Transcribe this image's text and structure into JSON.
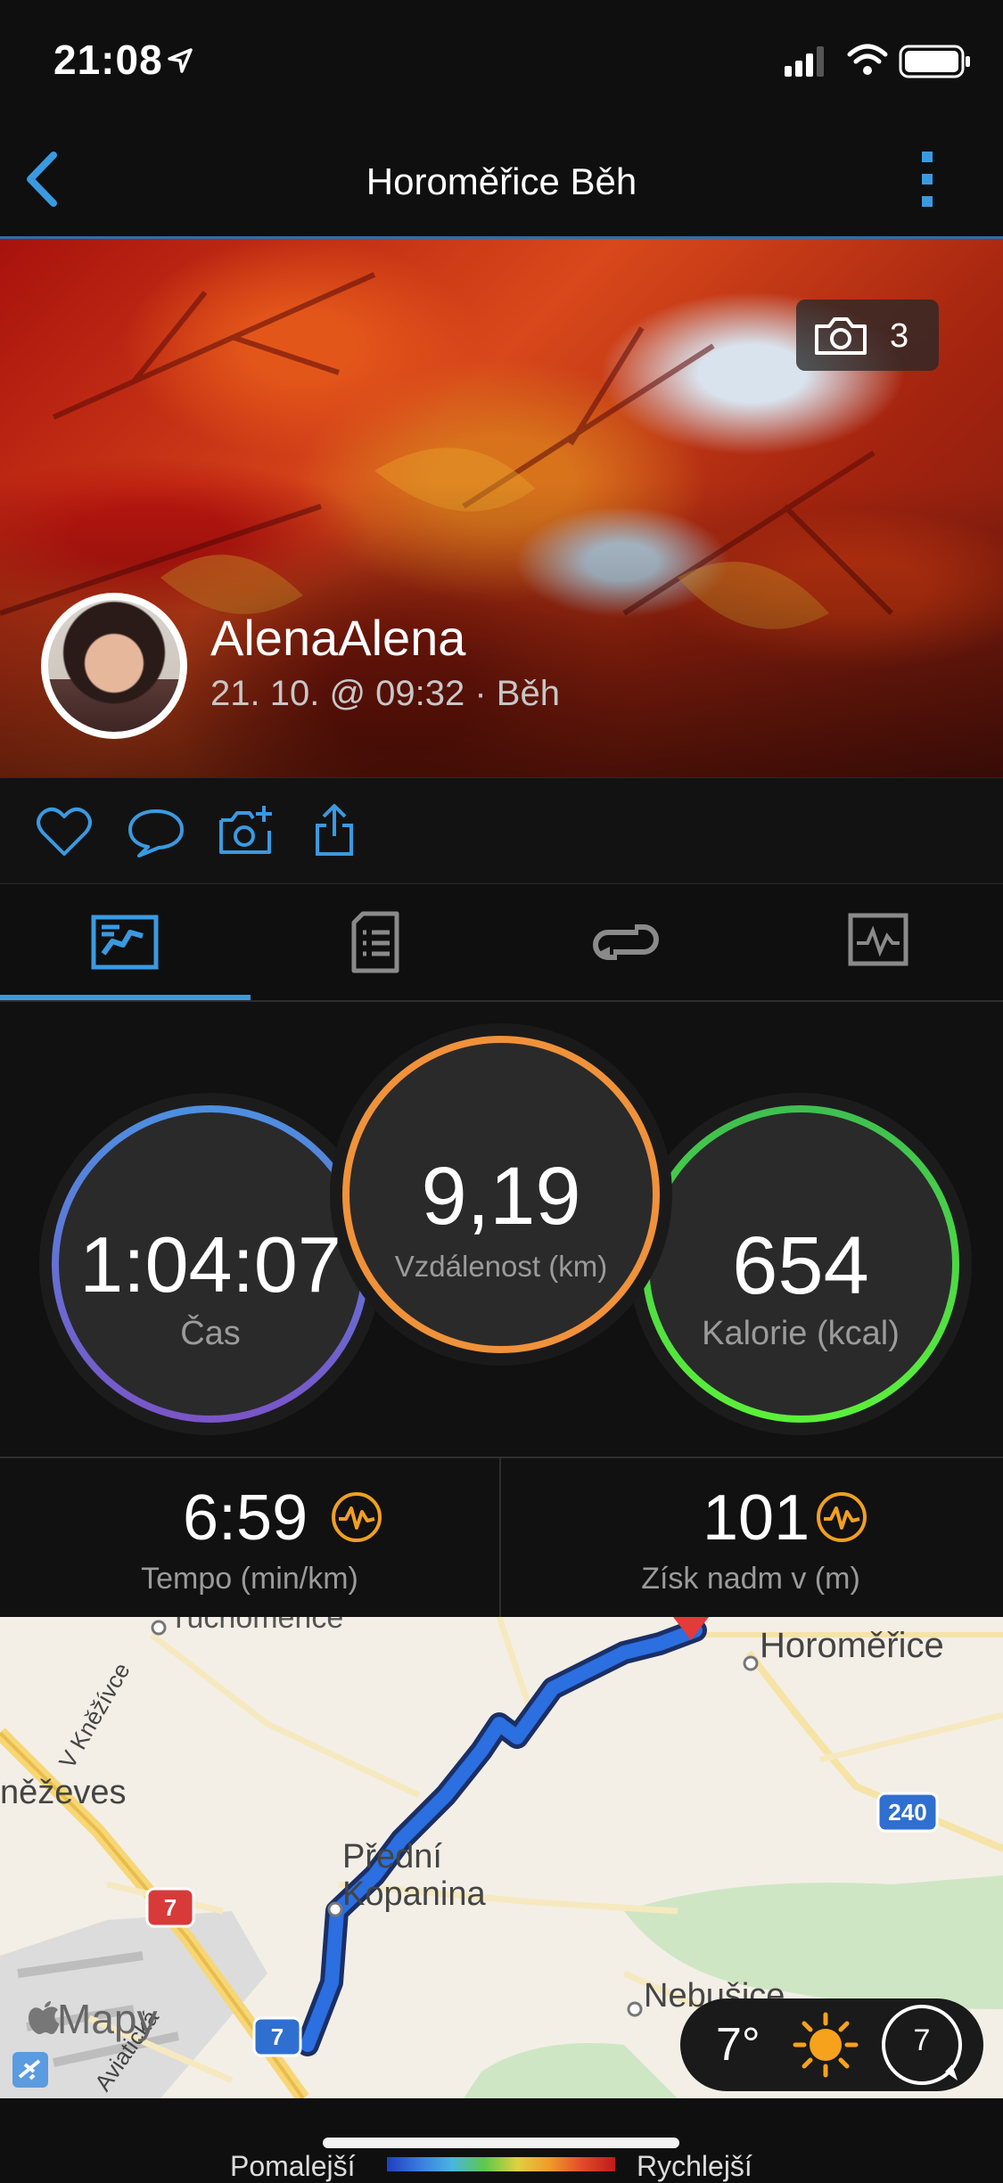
{
  "status_bar": {
    "time": "21:08"
  },
  "nav": {
    "title": "Horoměřice Běh"
  },
  "hero": {
    "photo_count": "3",
    "username": "AlenaAlena",
    "subline": "21. 10. @ 09:32 · Běh"
  },
  "stats": {
    "time_value": "1:04:07",
    "time_label": "Čas",
    "distance_value": "9,19",
    "distance_label": "Vzdálenost (km)",
    "calories_value": "654",
    "calories_label": "Kalorie (kcal)"
  },
  "metrics": {
    "pace_value": "6:59",
    "pace_label": "Tempo (min/km)",
    "elev_value": "101",
    "elev_label": "Získ nadm v (m)"
  },
  "map": {
    "labels": {
      "horomerice": "Horoměřice",
      "nezeves": "něževes",
      "predni": "Přední",
      "kopanina": "Kopanina",
      "nebusice": "Nebušice",
      "v_knezivce": "V Kněžívce",
      "top_village": "Tuchoměřice",
      "aviaticka": "Aviatická",
      "road_240": "240",
      "road_7a": "7",
      "road_7b": "7",
      "attribution": "Mapy"
    },
    "weather": {
      "temp": "7°",
      "wind": "7"
    }
  },
  "legend": {
    "slower": "Pomalejší",
    "faster": "Rychlejší"
  },
  "colors": {
    "accent_blue": "#3a9ae0",
    "ring_time": "#4d8fe0",
    "ring_distance": "#f0923a",
    "ring_calories": "#4fdc4a",
    "route": "#2b6fe0"
  }
}
